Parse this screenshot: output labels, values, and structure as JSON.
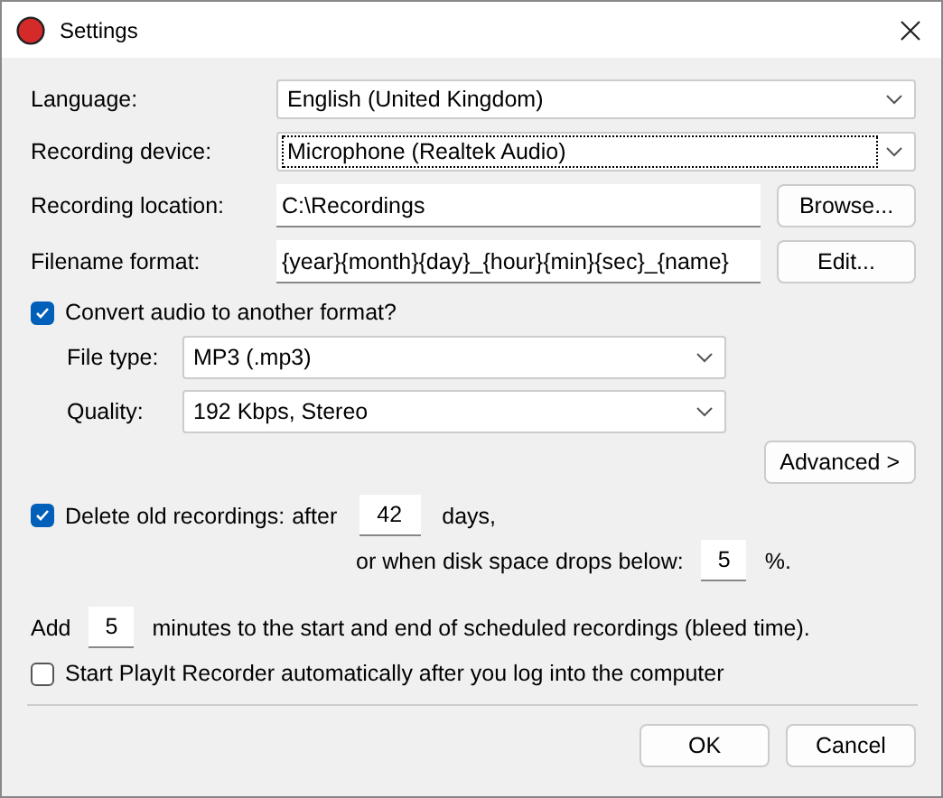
{
  "window": {
    "title": "Settings"
  },
  "fields": [
    {
      "label": "Language:",
      "kind": "dropdown",
      "value": "English (United Kingdom)",
      "focused": false
    },
    {
      "label": "Recording device:",
      "kind": "dropdown",
      "value": "Microphone (Realtek Audio)",
      "focused": true
    },
    {
      "label": "Recording location:",
      "kind": "text",
      "value": "C:\\Recordings",
      "button": "Browse..."
    },
    {
      "label": "Filename format:",
      "kind": "text",
      "value": "{year}{month}{day}_{hour}{min}{sec}_{name}",
      "button": "Edit..."
    }
  ],
  "convert": {
    "label": "Convert audio to another format?",
    "checked": true,
    "fields": [
      {
        "label": "File type:",
        "value": "MP3 (.mp3)"
      },
      {
        "label": "Quality:",
        "value": "192 Kbps, Stereo"
      }
    ],
    "advanced_button": "Advanced >"
  },
  "delete_old": {
    "label": "Delete old recordings:",
    "checked": true,
    "after": "after",
    "days": "42",
    "days_unit": "days,",
    "disk_label": "or when disk space drops below:",
    "disk_value": "5",
    "disk_unit": "%."
  },
  "bleed": {
    "prefix": "Add",
    "value": "5",
    "suffix": "minutes to the start and end of scheduled recordings (bleed time)."
  },
  "autostart": {
    "label": "Start PlayIt Recorder automatically after you log into the computer",
    "checked": false
  },
  "buttons": [
    "OK",
    "Cancel"
  ]
}
